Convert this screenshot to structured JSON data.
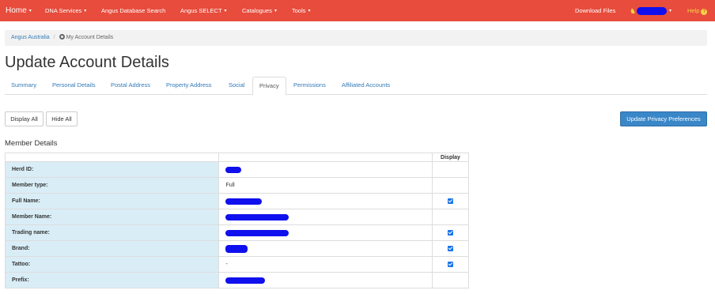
{
  "navbar": {
    "home": "Home",
    "items": [
      "DNA Services",
      "Angus Database Search",
      "Angus SELECT",
      "Catalogues",
      "Tools"
    ],
    "download": "Download Files",
    "help": "Help",
    "caret": "▾",
    "help_glyph": "?"
  },
  "breadcrumb": {
    "root": "Angus Australia",
    "separator": "/",
    "current": "My Account Details"
  },
  "page_title": "Update Account Details",
  "tabs": [
    "Summary",
    "Personal Details",
    "Postal Address",
    "Property Address",
    "Social",
    "Privacy",
    "Permissions",
    "Affiliated Accounts"
  ],
  "active_tab": "Privacy",
  "buttons": {
    "display_all": "Display All",
    "hide_all": "Hide All",
    "update": "Update Privacy Preferences"
  },
  "section_title": "Member Details",
  "table": {
    "header_display": "Display",
    "rows": [
      {
        "label": "Herd ID:",
        "value": "",
        "redacted": true,
        "checked": false
      },
      {
        "label": "Member type:",
        "value": "Full",
        "redacted": false,
        "checked": false
      },
      {
        "label": "Full Name:",
        "value": "",
        "redacted": true,
        "checked": true
      },
      {
        "label": "Member Name:",
        "value": "",
        "redacted": true,
        "checked": false
      },
      {
        "label": "Trading name:",
        "value": "",
        "redacted": true,
        "checked": true
      },
      {
        "label": "Brand:",
        "value": "",
        "redacted": true,
        "checked": true
      },
      {
        "label": "Tattoo:",
        "value": "-",
        "redacted": false,
        "checked": true
      },
      {
        "label": "Prefix:",
        "value": "",
        "redacted": true,
        "checked": false
      }
    ]
  },
  "colors": {
    "navbar": "#e74c3c",
    "link": "#337ab7",
    "label_cell": "#d9edf7",
    "primary_button": "#3a87c8",
    "redaction": "#1010ee"
  }
}
